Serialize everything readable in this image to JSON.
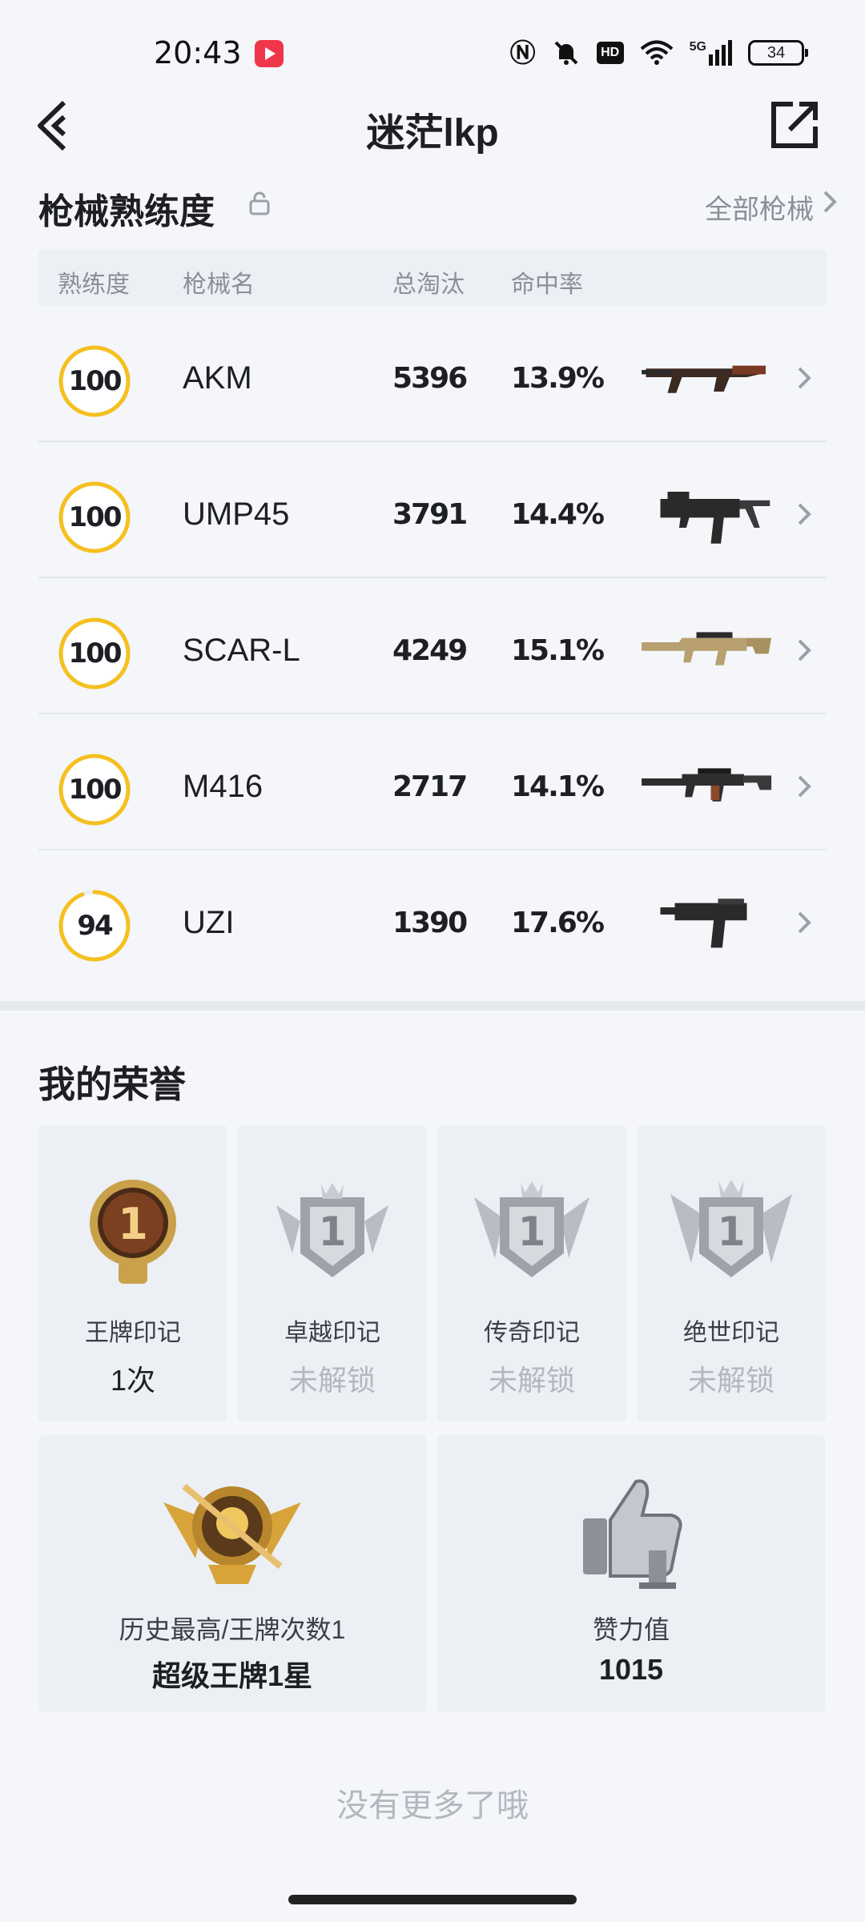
{
  "status_bar": {
    "time": "20:43",
    "icons": [
      "nfc-icon",
      "mute-icon",
      "hd-icon",
      "wifi-icon",
      "5g-signal-icon"
    ],
    "hd_label": "HD",
    "signal_label": "5G",
    "battery": "34"
  },
  "header": {
    "title": "迷茫lkp"
  },
  "weapons": {
    "section_title": "枪械熟练度",
    "all_link": "全部枪械",
    "columns": [
      "熟练度",
      "枪械名",
      "总淘汰",
      "命中率"
    ],
    "rows": [
      {
        "proficiency": 100,
        "proficiency_label": "100",
        "name": "AKM",
        "kills": "5396",
        "hit_rate": "13.9%",
        "gun_icon": "akm-icon"
      },
      {
        "proficiency": 100,
        "proficiency_label": "100",
        "name": "UMP45",
        "kills": "3791",
        "hit_rate": "14.4%",
        "gun_icon": "ump45-icon"
      },
      {
        "proficiency": 100,
        "proficiency_label": "100",
        "name": "SCAR-L",
        "kills": "4249",
        "hit_rate": "15.1%",
        "gun_icon": "scar-l-icon"
      },
      {
        "proficiency": 100,
        "proficiency_label": "100",
        "name": "M416",
        "kills": "2717",
        "hit_rate": "14.1%",
        "gun_icon": "m416-icon"
      },
      {
        "proficiency": 94,
        "proficiency_label": "94",
        "name": "UZI",
        "kills": "1390",
        "hit_rate": "17.6%",
        "gun_icon": "uzi-icon"
      }
    ],
    "ring_color": "#f5c020"
  },
  "honors": {
    "section_title": "我的荣誉",
    "badges": [
      {
        "name": "王牌印记",
        "value": "1次",
        "locked": false,
        "badge_digit": "1"
      },
      {
        "name": "卓越印记",
        "value": "未解锁",
        "locked": true,
        "badge_digit": "1"
      },
      {
        "name": "传奇印记",
        "value": "未解锁",
        "locked": true,
        "badge_digit": "1"
      },
      {
        "name": "绝世印记",
        "value": "未解锁",
        "locked": true,
        "badge_digit": "1"
      }
    ],
    "highest": {
      "name": "历史最高/王牌次数1",
      "value": "超级王牌1星"
    },
    "likes": {
      "name": "赞力值",
      "value": "1015"
    }
  },
  "footer": {
    "no_more": "没有更多了哦"
  }
}
